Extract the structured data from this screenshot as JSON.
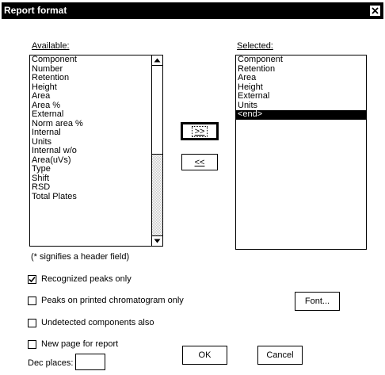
{
  "window": {
    "title": "Report format",
    "close_glyph": "×"
  },
  "available": {
    "label": "Available:",
    "items": [
      "Component",
      "Number",
      "Retention",
      "Height",
      "Area",
      "Area %",
      "External",
      "Norm area %",
      "Internal",
      "Units",
      "Internal w/o",
      "Area(uVs)",
      "Type",
      "Shift",
      "RSD",
      "Total Plates"
    ],
    "note": "(* signifies a header field)"
  },
  "selected": {
    "label": "Selected:",
    "items": [
      "Component",
      "Retention",
      "Area",
      "Height",
      "External",
      "Units",
      "<end>"
    ],
    "selected_index": 6
  },
  "buttons": {
    "add": ">>",
    "remove": "<<",
    "font": "Font...",
    "ok": "OK",
    "cancel": "Cancel"
  },
  "options": {
    "recognized_peaks": {
      "label": "Recognized peaks only",
      "checked": true
    },
    "peaks_printed": {
      "label": "Peaks on printed chromatogram only",
      "checked": false
    },
    "undetected": {
      "label": "Undetected components also",
      "checked": false
    },
    "new_page": {
      "label": "New page for report",
      "checked": false
    }
  },
  "dec_places": {
    "label": "Dec places:",
    "value": ""
  },
  "icons": {
    "check": "check-icon",
    "scroll_up": "arrow-up-icon",
    "scroll_down": "arrow-down-icon"
  }
}
